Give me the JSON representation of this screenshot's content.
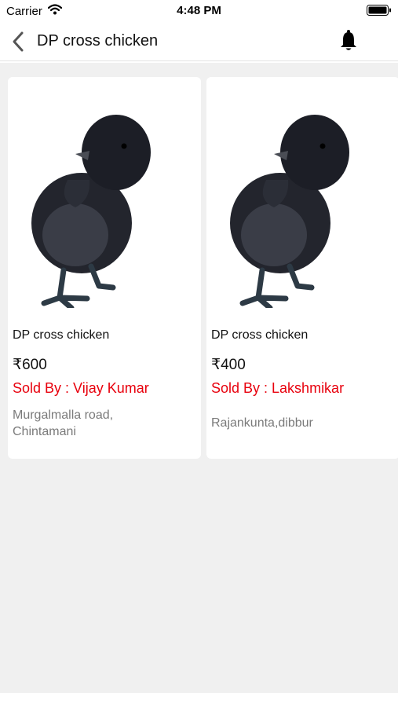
{
  "status_bar": {
    "carrier": "Carrier",
    "time": "4:48 PM",
    "icons": [
      "wifi-icon",
      "battery-icon"
    ]
  },
  "nav": {
    "title": "DP cross chicken",
    "icons": [
      "back-chevron-icon",
      "bell-icon"
    ]
  },
  "products": [
    {
      "title": "DP cross chicken",
      "price": "₹600",
      "seller": "Sold By : Vijay Kumar",
      "location": "Murgalmalla road, Chintamani",
      "image": "black-chick-image"
    },
    {
      "title": "DP cross chicken",
      "price": "₹400",
      "seller": "Sold By : Lakshmikar",
      "location": "Rajankunta,dibbur",
      "image": "black-chick-image"
    }
  ],
  "colors": {
    "seller_text": "#e8000d",
    "location_text": "#7a7a7a",
    "background": "#f0f0f0"
  }
}
